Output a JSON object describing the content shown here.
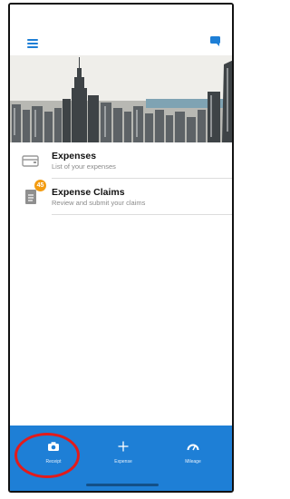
{
  "header": {
    "menu_icon": "hamburger-menu-icon",
    "chat_icon": "chat-bubble-icon",
    "accent": "#1e7fd6"
  },
  "hero": {
    "image": "new-york-skyline"
  },
  "list": [
    {
      "title": "Expenses",
      "subtitle": "List of your expenses",
      "icon": "wallet-icon"
    },
    {
      "title": "Expense Claims",
      "subtitle": "Review and submit your claims",
      "icon": "document-icon",
      "badge": "45"
    }
  ],
  "tabs": [
    {
      "label": "Receipt",
      "icon": "camera-icon"
    },
    {
      "label": "Expense",
      "icon": "plus-icon"
    },
    {
      "label": "Mileage",
      "icon": "speedometer-icon"
    }
  ],
  "colors": {
    "tab_bar": "#1e7fd6",
    "badge": "#f39c12",
    "annotation": "#e21b1b"
  }
}
